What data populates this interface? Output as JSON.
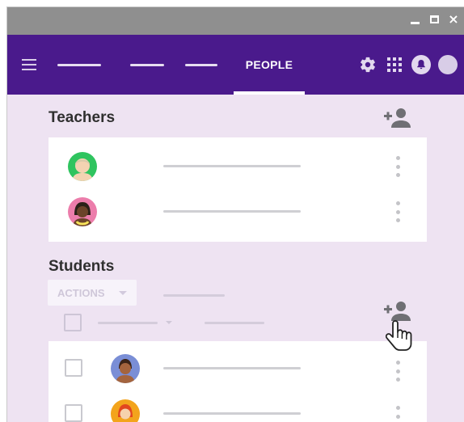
{
  "colors": {
    "brand": "#4a1a8c",
    "page_bg": "#eee3f2",
    "teacher1_avatar_bg": "#2fc45f",
    "teacher2_avatar_bg": "#ec7dab",
    "student1_avatar_bg": "#7a8ed6",
    "student2_avatar_bg": "#f3a41c"
  },
  "window": {
    "minimize": "minimize-icon",
    "maximize": "maximize-icon",
    "close_glyph": "×"
  },
  "appbar": {
    "menu_icon": "hamburger-menu-icon",
    "active_tab": "PEOPLE",
    "icons": [
      "settings-gear-icon",
      "apps-grid-icon",
      "notifications-bell-icon",
      "account-avatar"
    ]
  },
  "teachers": {
    "title": "Teachers",
    "add_icon": "add-person-icon",
    "rows": [
      {
        "avatar": "teacher-avatar"
      },
      {
        "avatar": "teacher-avatar"
      }
    ]
  },
  "students": {
    "title": "Students",
    "actions_label": "ACTIONS",
    "add_icon": "add-person-icon",
    "rows": [
      {
        "avatar": "student-avatar"
      },
      {
        "avatar": "student-avatar"
      }
    ]
  },
  "pointer": "hand-pointer-cursor"
}
